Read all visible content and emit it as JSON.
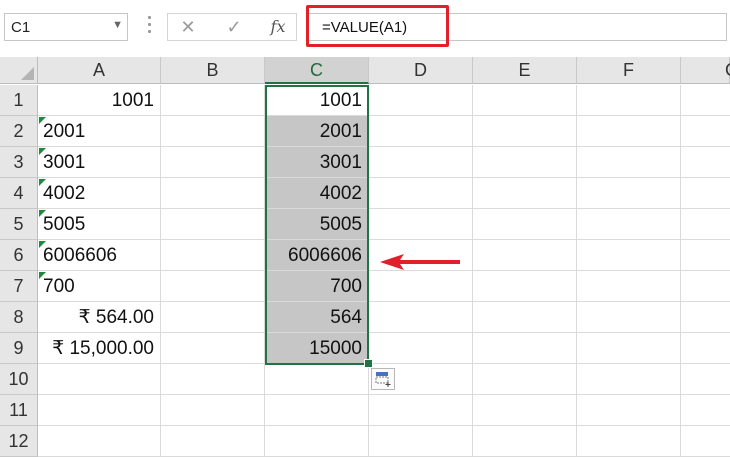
{
  "formula_bar": {
    "name_box": "C1",
    "cancel_icon": "✕",
    "enter_icon": "✓",
    "fx_label": "fx",
    "formula": "=VALUE(A1)"
  },
  "columns": [
    "A",
    "B",
    "C",
    "D",
    "E",
    "F",
    "G"
  ],
  "rows": [
    "1",
    "2",
    "3",
    "4",
    "5",
    "6",
    "7",
    "8",
    "9",
    "10",
    "11",
    "12"
  ],
  "cells": {
    "A": [
      "1001",
      "2001",
      "3001",
      "4002",
      "5005",
      "6006606",
      "700",
      "₹ 564.00",
      "₹ 15,000.00"
    ],
    "C": [
      "1001",
      "2001",
      "3001",
      "4002",
      "5005",
      "6006606",
      "700",
      "564",
      "15000"
    ]
  },
  "colors": {
    "highlight": "#e0202a",
    "selection": "#217346",
    "error_indicator": "#1e8a3c"
  },
  "icons": {
    "quick_analysis": "quick-analysis-icon",
    "annotation_arrow": "red-arrow-icon"
  }
}
